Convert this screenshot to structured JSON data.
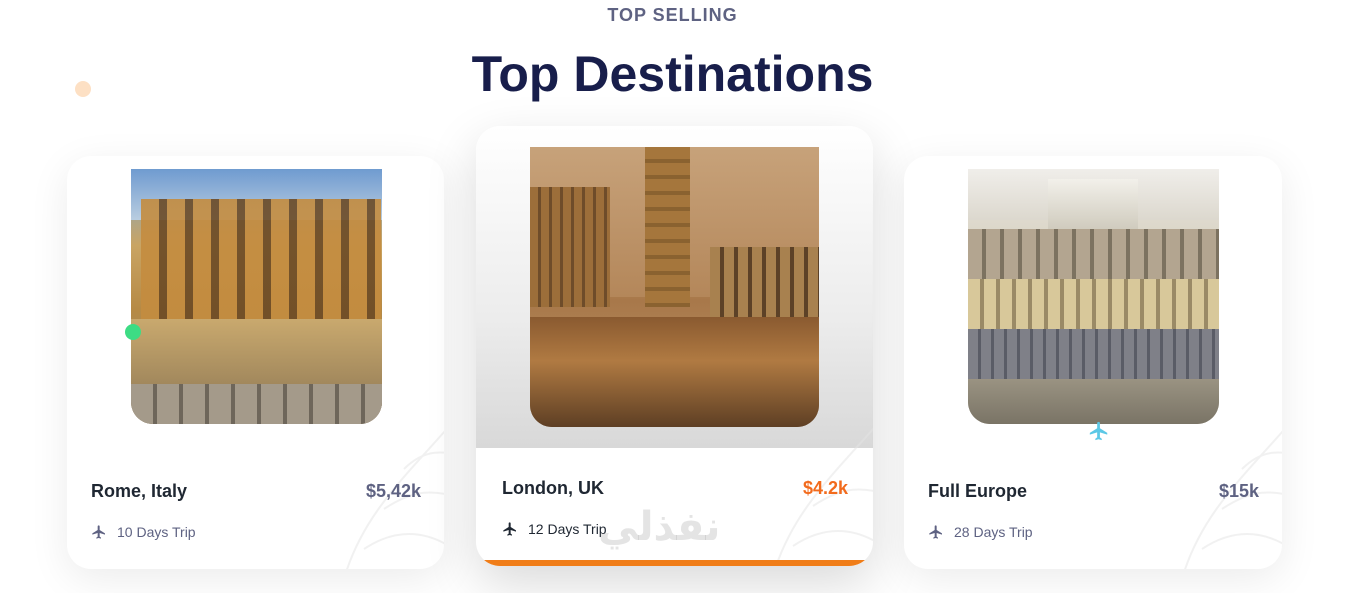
{
  "section": {
    "subtitle": "TOP SELLING",
    "title": "Top Destinations"
  },
  "destinations": [
    {
      "name": "Rome, Italy",
      "price": "$5,42k",
      "duration": "10 Days Trip",
      "icon": "airplane-icon"
    },
    {
      "name": "London, UK",
      "price": "$4.2k",
      "duration": "12 Days Trip",
      "icon": "airplane-icon"
    },
    {
      "name": "Full Europe",
      "price": "$15k",
      "duration": "28 Days Trip",
      "icon": "airplane-icon"
    }
  ],
  "watermark": "نفذلي",
  "colors": {
    "accent": "#f26b1d",
    "title": "#181e4b",
    "muted": "#5e6282",
    "online_dot": "#3ddc84",
    "plane_float": "#5cc8e6",
    "bar": "#f07d18"
  }
}
